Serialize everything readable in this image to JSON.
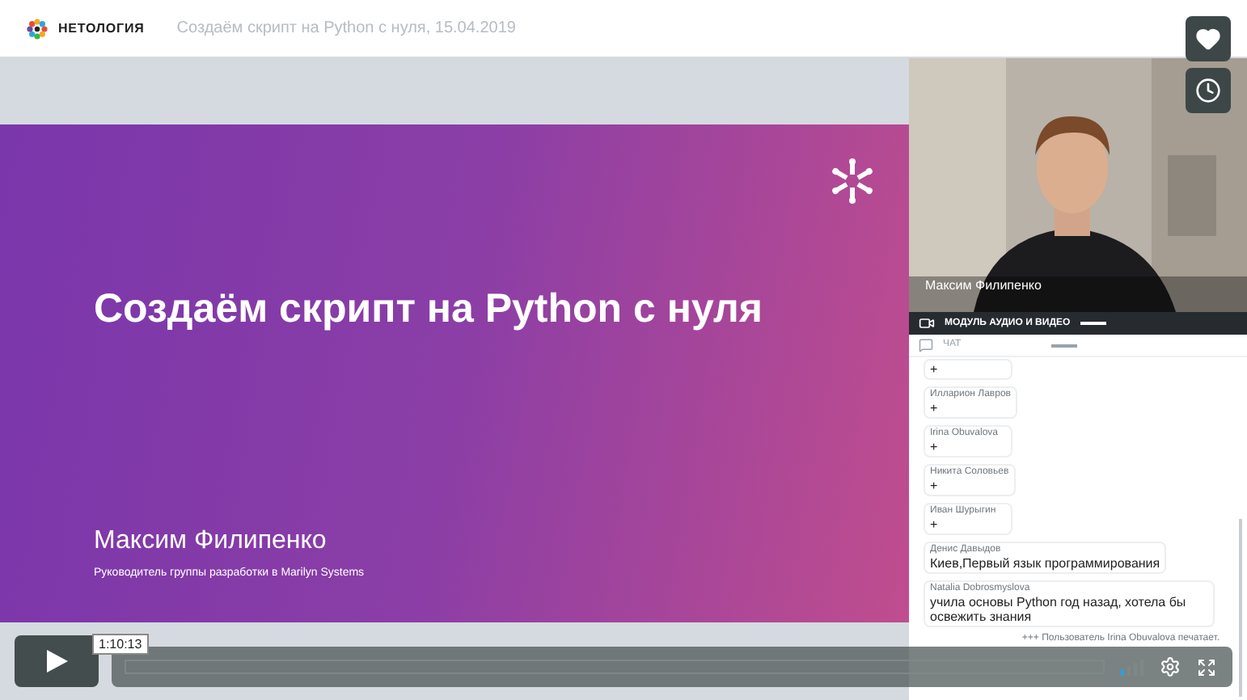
{
  "header": {
    "logo_text": "НЕТОЛОГИЯ",
    "title": "Создаём скрипт на Python с нуля, 15.04.2019"
  },
  "slide": {
    "title": "Создаём скрипт на Python с нуля",
    "speaker_name": "Максим Филипенко",
    "speaker_role": "Руководитель группы разработки в Marilyn Systems"
  },
  "video": {
    "caption": "Максим Филипенко"
  },
  "av_module": {
    "label": "МОДУЛЬ АУДИО И ВИДЕО"
  },
  "chat": {
    "label": "ЧАТ",
    "messages": [
      {
        "text": "+"
      },
      {
        "author": "Илларион Лавров",
        "text": "+"
      },
      {
        "author": "Irina Obuvalova",
        "text": "+"
      },
      {
        "author": "Никита Соловьев",
        "text": "+"
      },
      {
        "author": "Иван Шурыгин",
        "text": "+"
      },
      {
        "author": "Денис Давыдов",
        "text": "Киев,Первый язык программирования"
      },
      {
        "author": "Natalia Dobrosmyslova",
        "text": "учила основы Python год назад, хотела бы освежить знания"
      }
    ],
    "typing": "+++ Пользователь Irina Obuvalova печатает."
  },
  "player": {
    "time_tooltip": "1:10:13"
  }
}
